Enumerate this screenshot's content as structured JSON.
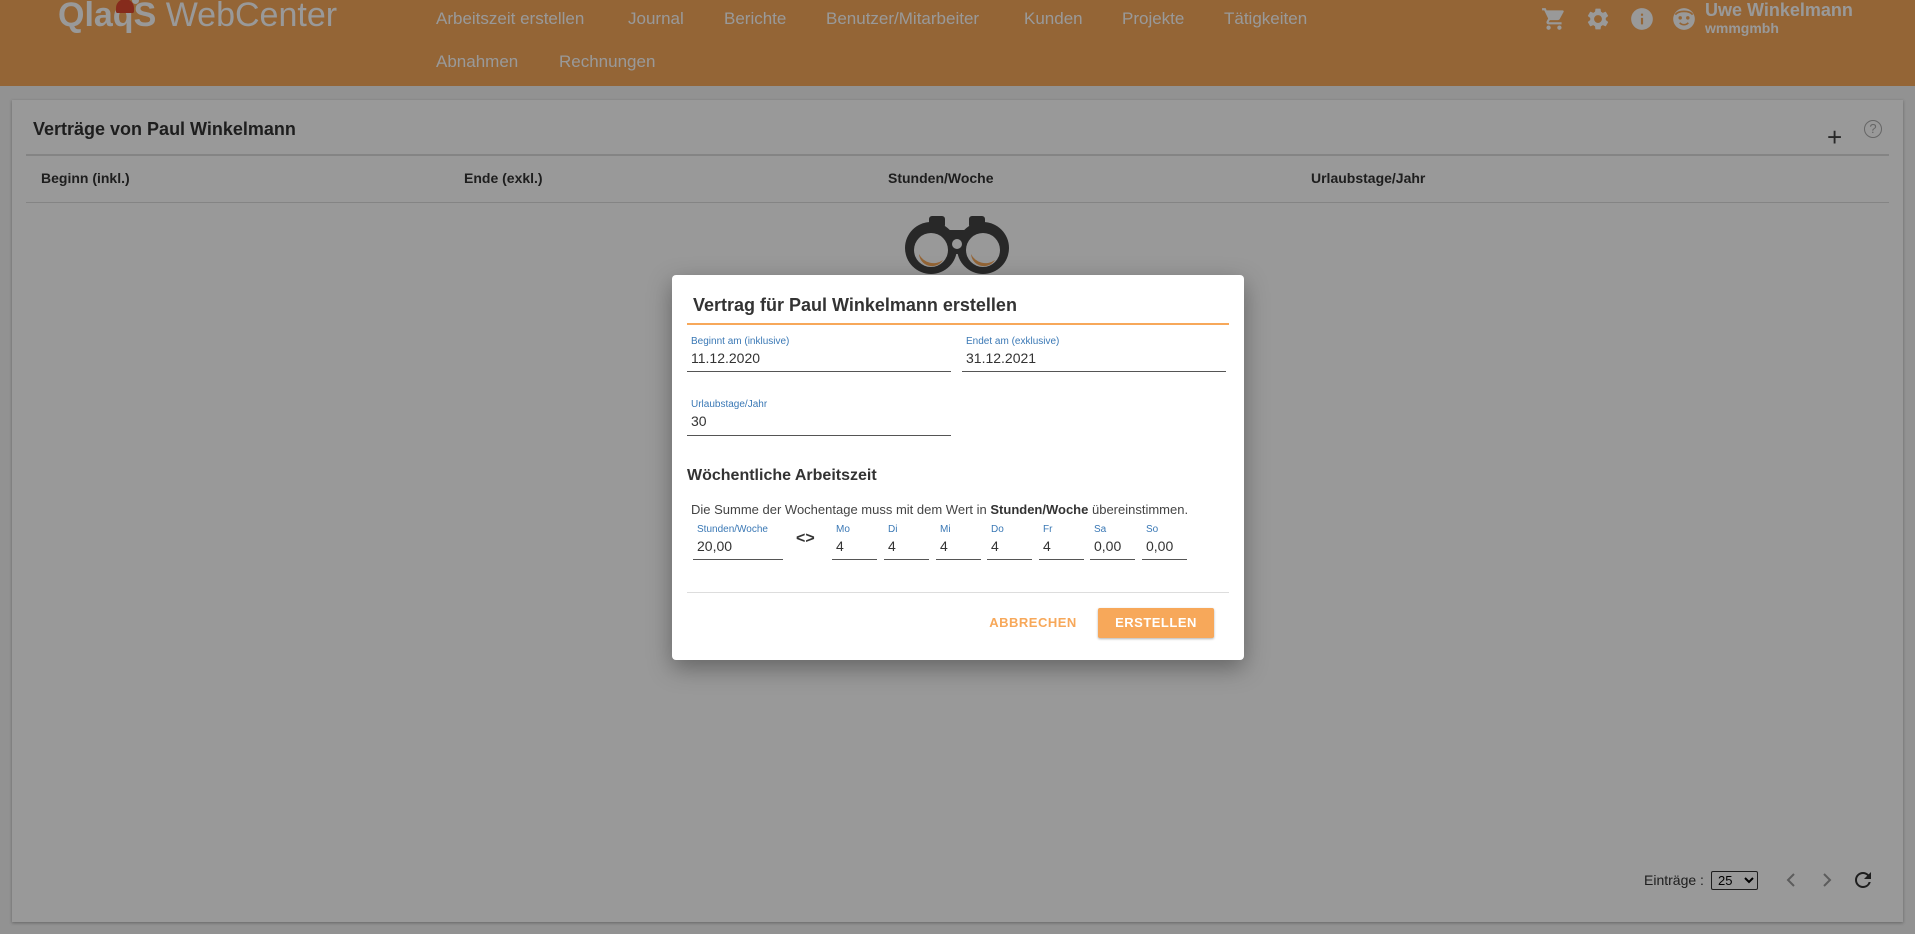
{
  "app": {
    "logo_brand": "QlaqS",
    "logo_product": "WebCenter"
  },
  "nav": {
    "items": [
      "Arbeitszeit erstellen",
      "Journal",
      "Berichte",
      "Benutzer/Mitarbeiter",
      "Kunden",
      "Projekte",
      "Tätigkeiten",
      "Abnahmen",
      "Rechnungen"
    ]
  },
  "header_icons": [
    "cart-icon",
    "gear-icon",
    "info-icon",
    "user-avatar-icon"
  ],
  "user": {
    "name": "Uwe Winkelmann",
    "company": "wmmgmbh"
  },
  "card": {
    "title": "Verträge von Paul Winkelmann",
    "add_label": "+",
    "help_label": "?",
    "columns": [
      "Beginn (inkl.)",
      "Ende (exkl.)",
      "Stunden/Woche",
      "Urlaubstage/Jahr"
    ],
    "empty_icon": "binoculars-icon"
  },
  "pagination": {
    "entries_label": "Einträge :",
    "page_size": "25",
    "page_size_options": [
      "25"
    ]
  },
  "dialog": {
    "title": "Vertrag für Paul Winkelmann erstellen",
    "start_label": "Beginnt am (inklusive)",
    "start_value": "11.12.2020",
    "end_label": "Endet am (exklusive)",
    "end_value": "31.12.2021",
    "vacation_label": "Urlaubstage/Jahr",
    "vacation_value": "30",
    "weekly_title": "Wöchentliche Arbeitszeit",
    "hint_prefix": "Die Summe der Wochentage muss mit dem Wert in",
    "hint_bold": "Stunden/Woche",
    "hint_suffix": "übereinstimmen.",
    "hours_label": "Stunden/Woche",
    "hours_value": "20,00",
    "swap_symbol": "<>",
    "days": [
      {
        "label": "Mo",
        "value": "4"
      },
      {
        "label": "Di",
        "value": "4"
      },
      {
        "label": "Mi",
        "value": "4"
      },
      {
        "label": "Do",
        "value": "4"
      },
      {
        "label": "Fr",
        "value": "4"
      },
      {
        "label": "Sa",
        "value": "0,00"
      },
      {
        "label": "So",
        "value": "0,00"
      }
    ],
    "cancel_label": "ABBRECHEN",
    "create_label": "ERSTELLEN"
  },
  "colors": {
    "accent": "#f7a85a",
    "label_blue": "#3a78b5"
  }
}
